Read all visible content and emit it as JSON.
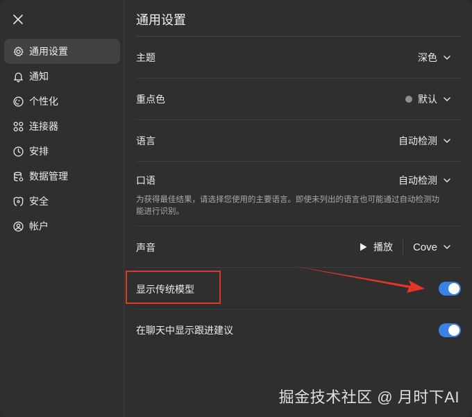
{
  "page_title": "通用设置",
  "sidebar": {
    "items": [
      {
        "label": "通用设置",
        "icon": "gear-icon",
        "active": true
      },
      {
        "label": "通知",
        "icon": "bell-icon"
      },
      {
        "label": "个性化",
        "icon": "personalize-icon"
      },
      {
        "label": "连接器",
        "icon": "connectors-icon"
      },
      {
        "label": "安排",
        "icon": "clock-icon"
      },
      {
        "label": "数据管理",
        "icon": "database-icon"
      },
      {
        "label": "安全",
        "icon": "shield-icon"
      },
      {
        "label": "帐户",
        "icon": "account-icon"
      }
    ]
  },
  "settings": {
    "theme": {
      "label": "主题",
      "value": "深色"
    },
    "accent": {
      "label": "重点色",
      "value": "默认",
      "dot_color": "#8e8e8e"
    },
    "language": {
      "label": "语言",
      "value": "自动检测"
    },
    "spoken": {
      "label": "口语",
      "value": "自动检测",
      "description": "为获得最佳结果，请选择您使用的主要语言。即使未列出的语言也可能通过自动检测功能进行识别。"
    },
    "voice": {
      "label": "声音",
      "play_label": "播放",
      "value": "Cove"
    },
    "legacy_models": {
      "label": "显示传统模型",
      "enabled": true
    },
    "followups": {
      "label": "在聊天中显示跟进建议",
      "enabled": true
    }
  },
  "colors": {
    "toggle_on": "#3b82e8",
    "annotation": "#e53527"
  },
  "watermark": "掘金技术社区 @ 月时下AI"
}
